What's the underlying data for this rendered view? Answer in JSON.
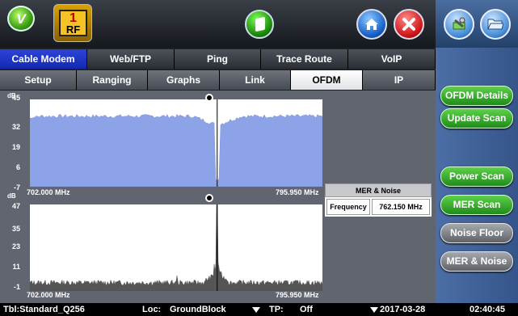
{
  "header": {
    "logo_letter": "V",
    "rf_badge": {
      "number": "1",
      "label": "RF"
    }
  },
  "tabs_primary": [
    {
      "label": "Cable Modem",
      "active": true
    },
    {
      "label": "Web/FTP",
      "active": false
    },
    {
      "label": "Ping",
      "active": false
    },
    {
      "label": "Trace Route",
      "active": false
    },
    {
      "label": "VoIP",
      "active": false
    }
  ],
  "tabs_secondary": [
    {
      "label": "Setup",
      "active": false
    },
    {
      "label": "Ranging",
      "active": false
    },
    {
      "label": "Graphs",
      "active": false
    },
    {
      "label": "Link",
      "active": false
    },
    {
      "label": "OFDM",
      "active": true
    },
    {
      "label": "IP",
      "active": false
    }
  ],
  "side_buttons": {
    "ofdm_details": "OFDM Details",
    "update_scan": "Update Scan",
    "power_scan": "Power Scan",
    "mer_scan": "MER Scan",
    "noise_floor": "Noise Floor",
    "mer_noise": "MER & Noise"
  },
  "chart_data": [
    {
      "type": "area",
      "ylabel": "dB",
      "yticks": [
        45,
        32,
        19,
        6,
        -7
      ],
      "ylim": [
        -7,
        45
      ],
      "xlim": [
        "702.000 MHz",
        "795.950 MHz"
      ],
      "x_start_label": "702.000 MHz",
      "x_end_label": "795.950 MHz",
      "level": 35,
      "notch_center_mhz": 762.15,
      "color": "#8da3e8"
    },
    {
      "type": "area",
      "ylabel": "dB",
      "yticks": [
        47,
        35,
        23,
        11,
        -1
      ],
      "ylim": [
        -1,
        47
      ],
      "xlim": [
        "702.000 MHz",
        "795.950 MHz"
      ],
      "x_start_label": "702.000 MHz",
      "x_end_label": "795.950 MHz",
      "floor_level": 3,
      "peak_center_mhz": 762.15,
      "peak_value": 47,
      "color": "#555555"
    }
  ],
  "mer_noise": {
    "title": "MER & Noise",
    "frequency_label": "Frequency",
    "frequency_value": "762.150 MHz"
  },
  "status": {
    "table": "Tbl:Standard_Q256",
    "loc_label": "Loc:",
    "loc_value": "GroundBlock",
    "tp_label": "TP:",
    "tp_value": "Off",
    "date": "2017-03-28",
    "time": "02:40:45"
  },
  "colors": {
    "active_primary_tab": "#1f35c8",
    "side_button_green": "#2fa52a",
    "right_panel": "#4065a0"
  }
}
